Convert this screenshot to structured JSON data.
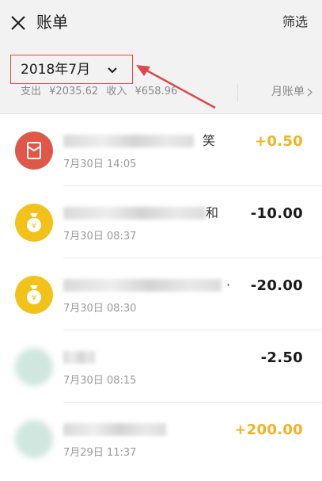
{
  "nav": {
    "close_icon": "close-icon",
    "title": "账单",
    "filter_label": "筛选"
  },
  "summary": {
    "month_label": "2018年7月",
    "expense_label": "支出",
    "expense_value": "¥2035.62",
    "income_label": "收入",
    "income_value": "¥658.96",
    "monthly_label": "月账单",
    "annotation_color": "#e04747"
  },
  "transactions": [
    {
      "icon": "red-packet-icon",
      "icon_color": "#e0574a",
      "title_visible": "笑",
      "date": "7月30日 14:05",
      "amount": "+0.50",
      "direction": "income"
    },
    {
      "icon": "money-bag-icon",
      "icon_color": "#f2c21b",
      "title_visible": "和",
      "date": "7月30日 08:37",
      "amount": "-10.00",
      "direction": "expense"
    },
    {
      "icon": "money-bag-icon",
      "icon_color": "#f2c21b",
      "title_visible": "·",
      "date": "7月30日 08:30",
      "amount": "-20.00",
      "direction": "expense"
    },
    {
      "icon": "blurred-avatar-icon",
      "icon_color": "#cfe7de",
      "title_visible": "",
      "date": "7月30日 08:15",
      "amount": "-2.50",
      "direction": "expense"
    },
    {
      "icon": "blurred-avatar-icon",
      "icon_color": "#cfe7de",
      "title_visible": "",
      "date": "7月29日 11:37",
      "amount": "+200.00",
      "direction": "income"
    }
  ],
  "colors": {
    "income": "#f0b323",
    "expense": "#1a1a1a",
    "header_bg": "#f2f2f2"
  }
}
